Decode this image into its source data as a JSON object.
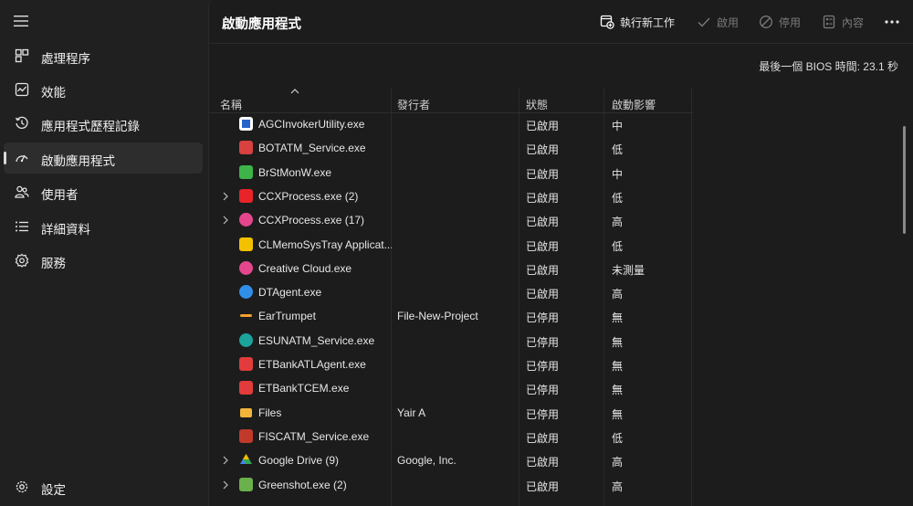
{
  "sidebar": {
    "items": [
      {
        "label": "處理程序",
        "icon": "processes-icon"
      },
      {
        "label": "效能",
        "icon": "performance-icon"
      },
      {
        "label": "應用程式歷程記錄",
        "icon": "history-icon"
      },
      {
        "label": "啟動應用程式",
        "icon": "startup-icon"
      },
      {
        "label": "使用者",
        "icon": "users-icon"
      },
      {
        "label": "詳細資料",
        "icon": "details-icon"
      },
      {
        "label": "服務",
        "icon": "services-icon"
      }
    ],
    "settings_label": "設定"
  },
  "header": {
    "title": "啟動應用程式",
    "run_task": "執行新工作",
    "enable": "啟用",
    "disable": "停用",
    "properties": "內容"
  },
  "bios_text": "最後一個 BIOS 時間:  23.1 秒",
  "table": {
    "columns": {
      "name": "名稱",
      "publisher": "發行者",
      "status": "狀態",
      "impact": "啟動影響"
    },
    "rows": [
      {
        "name": "AGCInvokerUtility.exe",
        "publisher": "",
        "status": "已啟用",
        "impact": "中",
        "expand": false,
        "icon": "blue-window-icon",
        "color": "#ffffff"
      },
      {
        "name": "BOTATM_Service.exe",
        "publisher": "",
        "status": "已啟用",
        "impact": "低",
        "expand": false,
        "icon": "bot-bank-icon",
        "color": "#d94040"
      },
      {
        "name": "BrStMonW.exe",
        "publisher": "",
        "status": "已啟用",
        "impact": "中",
        "expand": false,
        "icon": "brother-monitor-icon",
        "color": "#3cb44a"
      },
      {
        "name": "CCXProcess.exe (2)",
        "publisher": "",
        "status": "已啟用",
        "impact": "低",
        "expand": true,
        "icon": "adobe-cc-red-icon",
        "color": "#e8232a"
      },
      {
        "name": "CCXProcess.exe (17)",
        "publisher": "",
        "status": "已啟用",
        "impact": "高",
        "expand": true,
        "icon": "creative-cloud-icon",
        "color": "#e4468c"
      },
      {
        "name": "CLMemoSysTray Applicat...",
        "publisher": "",
        "status": "已啟用",
        "impact": "低",
        "expand": false,
        "icon": "clmemo-icon",
        "color": "#f2c200"
      },
      {
        "name": "Creative Cloud.exe",
        "publisher": "",
        "status": "已啟用",
        "impact": "未測量",
        "expand": false,
        "icon": "creative-cloud-icon",
        "color": "#e4468c"
      },
      {
        "name": "DTAgent.exe",
        "publisher": "",
        "status": "已啟用",
        "impact": "高",
        "expand": false,
        "icon": "dtagent-icon",
        "color": "#2f8fe8"
      },
      {
        "name": "EarTrumpet",
        "publisher": "File-New-Project",
        "status": "已停用",
        "impact": "無",
        "expand": false,
        "icon": "eartrumpet-icon",
        "color": "#f0a030"
      },
      {
        "name": "ESUNATM_Service.exe",
        "publisher": "",
        "status": "已停用",
        "impact": "無",
        "expand": false,
        "icon": "esun-bank-icon",
        "color": "#1ba39c"
      },
      {
        "name": "ETBankATLAgent.exe",
        "publisher": "",
        "status": "已停用",
        "impact": "無",
        "expand": false,
        "icon": "etbank-icon",
        "color": "#e23b3b"
      },
      {
        "name": "ETBankTCEM.exe",
        "publisher": "",
        "status": "已停用",
        "impact": "無",
        "expand": false,
        "icon": "etbank-icon",
        "color": "#e23b3b"
      },
      {
        "name": "Files",
        "publisher": "Yair A",
        "status": "已停用",
        "impact": "無",
        "expand": false,
        "icon": "folder-icon",
        "color": "#f2b43a"
      },
      {
        "name": "FISCATM_Service.exe",
        "publisher": "",
        "status": "已啟用",
        "impact": "低",
        "expand": false,
        "icon": "fisc-icon",
        "color": "#c0392b"
      },
      {
        "name": "Google Drive (9)",
        "publisher": "Google, Inc.",
        "status": "已啟用",
        "impact": "高",
        "expand": true,
        "icon": "google-drive-icon",
        "color": "#34a853"
      },
      {
        "name": "Greenshot.exe (2)",
        "publisher": "",
        "status": "已啟用",
        "impact": "高",
        "expand": true,
        "icon": "greenshot-icon",
        "color": "#6ab04c"
      }
    ]
  }
}
